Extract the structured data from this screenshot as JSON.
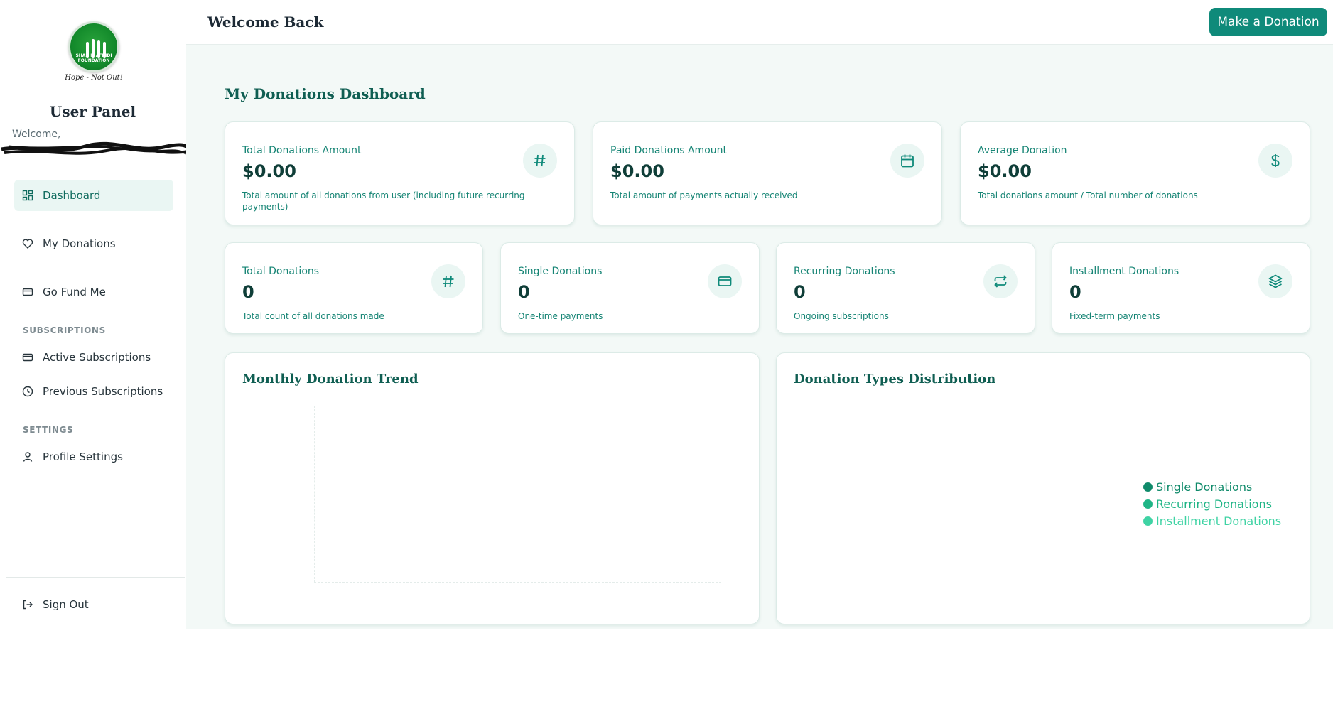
{
  "sidebar": {
    "logo_text": "SHAHID AFRIDI FOUNDATION",
    "tagline": "Hope - Not Out!",
    "panel_title": "User Panel",
    "welcome_label": "Welcome,",
    "nav": {
      "dashboard": "Dashboard",
      "my_donations": "My Donations",
      "go_fund_me": "Go Fund Me",
      "subscriptions_section": "SUBSCRIPTIONS",
      "active_subscriptions": "Active Subscriptions",
      "previous_subscriptions": "Previous Subscriptions",
      "settings_section": "SETTINGS",
      "profile_settings": "Profile Settings",
      "sign_out": "Sign Out"
    }
  },
  "header": {
    "title": "Welcome Back",
    "cta": "Make a Donation"
  },
  "dashboard": {
    "title": "My Donations Dashboard",
    "stats_top": [
      {
        "label": "Total Donations Amount",
        "value": "$0.00",
        "desc": "Total amount of all donations from user (including future recurring payments)",
        "icon": "hash-icon"
      },
      {
        "label": "Paid Donations Amount",
        "value": "$0.00",
        "desc": "Total amount of payments actually received",
        "icon": "calendar-icon"
      },
      {
        "label": "Average Donation",
        "value": "$0.00",
        "desc": "Total donations amount / Total number of donations",
        "icon": "dollar-icon"
      }
    ],
    "stats_bottom": [
      {
        "label": "Total Donations",
        "value": "0",
        "desc": "Total count of all donations made",
        "icon": "hash-icon"
      },
      {
        "label": "Single Donations",
        "value": "0",
        "desc": "One-time payments",
        "icon": "credit-card-icon"
      },
      {
        "label": "Recurring Donations",
        "value": "0",
        "desc": "Ongoing subscriptions",
        "icon": "repeat-icon"
      },
      {
        "label": "Installment Donations",
        "value": "0",
        "desc": "Fixed-term payments",
        "icon": "layers-icon"
      }
    ],
    "monthly_trend": {
      "title": "Monthly Donation Trend"
    },
    "types_distribution": {
      "title": "Donation Types Distribution",
      "legend": [
        {
          "name": "Single Donations",
          "color": "#0f8a6a"
        },
        {
          "name": "Recurring Donations",
          "color": "#1fb586"
        },
        {
          "name": "Installment Donations",
          "color": "#3fd3a4"
        }
      ]
    }
  },
  "colors": {
    "accent": "#0f8a7a",
    "accent_light": "#eaf6f3",
    "text_teal": "#158474",
    "text_dark": "#0f3e38"
  }
}
